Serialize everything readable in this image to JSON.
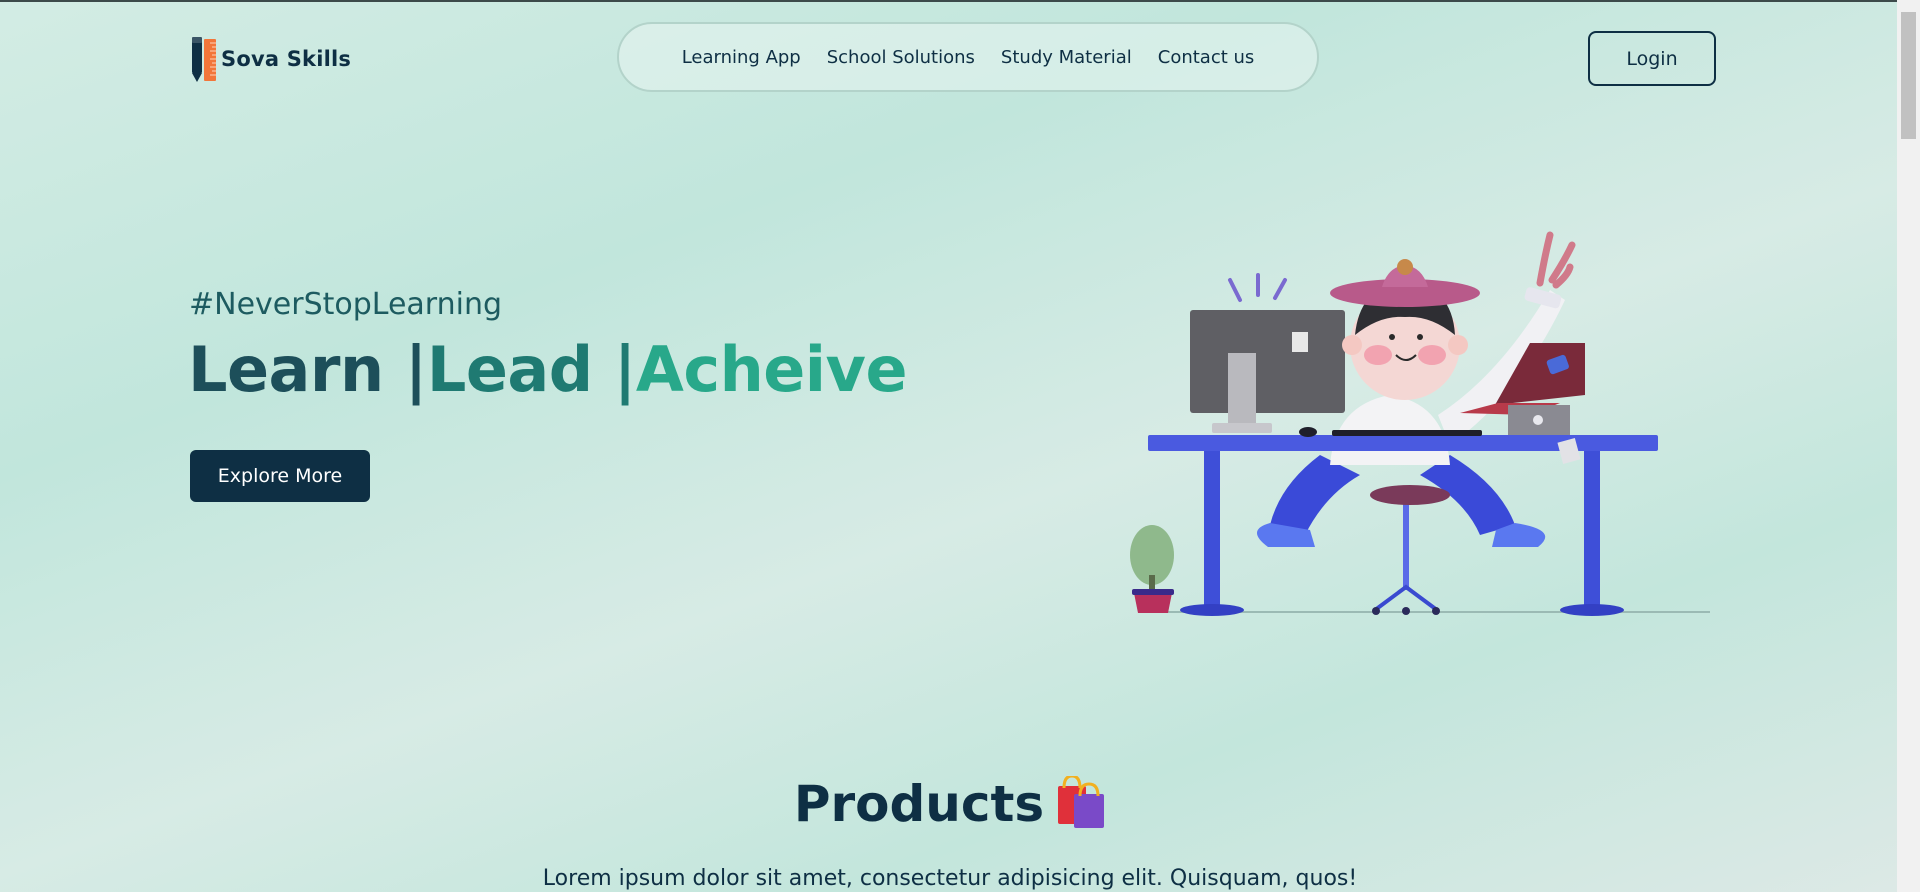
{
  "brand": {
    "name": "Sova Skills",
    "icon": "pencil-ruler-icon"
  },
  "nav": {
    "items": [
      "Learning App",
      "School Solutions",
      "Study Material",
      "Contact us"
    ]
  },
  "header": {
    "login_label": "Login"
  },
  "hero": {
    "tagline": "#NeverStopLearning",
    "headline_parts": [
      "Learn | ",
      "Lead | ",
      "Acheive"
    ],
    "cta_label": "Explore More",
    "illustration": "person-at-desk-illustration"
  },
  "products": {
    "title": "Products",
    "icon": "shopping-bags-icon",
    "description": "Lorem ipsum dolor sit amet, consectetur adipisicing elit. Quisquam, quos!"
  },
  "colors": {
    "primary": "#0e2f44",
    "accent_teal": "#28a88a",
    "accent_mid": "#1f7a72",
    "background": "#c1e6dc"
  }
}
